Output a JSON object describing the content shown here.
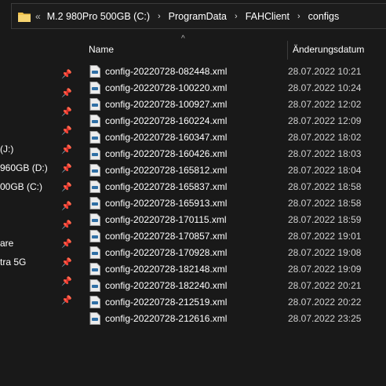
{
  "addressbar": {
    "overflow_glyph": "«",
    "crumbs": [
      "M.2 980Pro 500GB  (C:)",
      "ProgramData",
      "FAHClient",
      "configs"
    ],
    "separator_glyph": "›"
  },
  "nav": {
    "pin_glyph": "📌",
    "items": [
      "(J:)",
      "960GB (D:)",
      "00GB  (C:)",
      "are",
      "tra 5G"
    ]
  },
  "columns": {
    "name": "Name",
    "date": "Änderungsdatum",
    "sort_glyph": "^"
  },
  "files": [
    {
      "name": "config-20220728-082448.xml",
      "date": "28.07.2022 10:21"
    },
    {
      "name": "config-20220728-100220.xml",
      "date": "28.07.2022 10:24"
    },
    {
      "name": "config-20220728-100927.xml",
      "date": "28.07.2022 12:02"
    },
    {
      "name": "config-20220728-160224.xml",
      "date": "28.07.2022 12:09"
    },
    {
      "name": "config-20220728-160347.xml",
      "date": "28.07.2022 18:02"
    },
    {
      "name": "config-20220728-160426.xml",
      "date": "28.07.2022 18:03"
    },
    {
      "name": "config-20220728-165812.xml",
      "date": "28.07.2022 18:04"
    },
    {
      "name": "config-20220728-165837.xml",
      "date": "28.07.2022 18:58"
    },
    {
      "name": "config-20220728-165913.xml",
      "date": "28.07.2022 18:58"
    },
    {
      "name": "config-20220728-170115.xml",
      "date": "28.07.2022 18:59"
    },
    {
      "name": "config-20220728-170857.xml",
      "date": "28.07.2022 19:01"
    },
    {
      "name": "config-20220728-170928.xml",
      "date": "28.07.2022 19:08"
    },
    {
      "name": "config-20220728-182148.xml",
      "date": "28.07.2022 19:09"
    },
    {
      "name": "config-20220728-182240.xml",
      "date": "28.07.2022 20:21"
    },
    {
      "name": "config-20220728-212519.xml",
      "date": "28.07.2022 20:22"
    },
    {
      "name": "config-20220728-212616.xml",
      "date": "28.07.2022 23:25"
    }
  ],
  "colors": {
    "background": "#191919",
    "folder": "#f0c24a",
    "text": "#ffffff"
  }
}
